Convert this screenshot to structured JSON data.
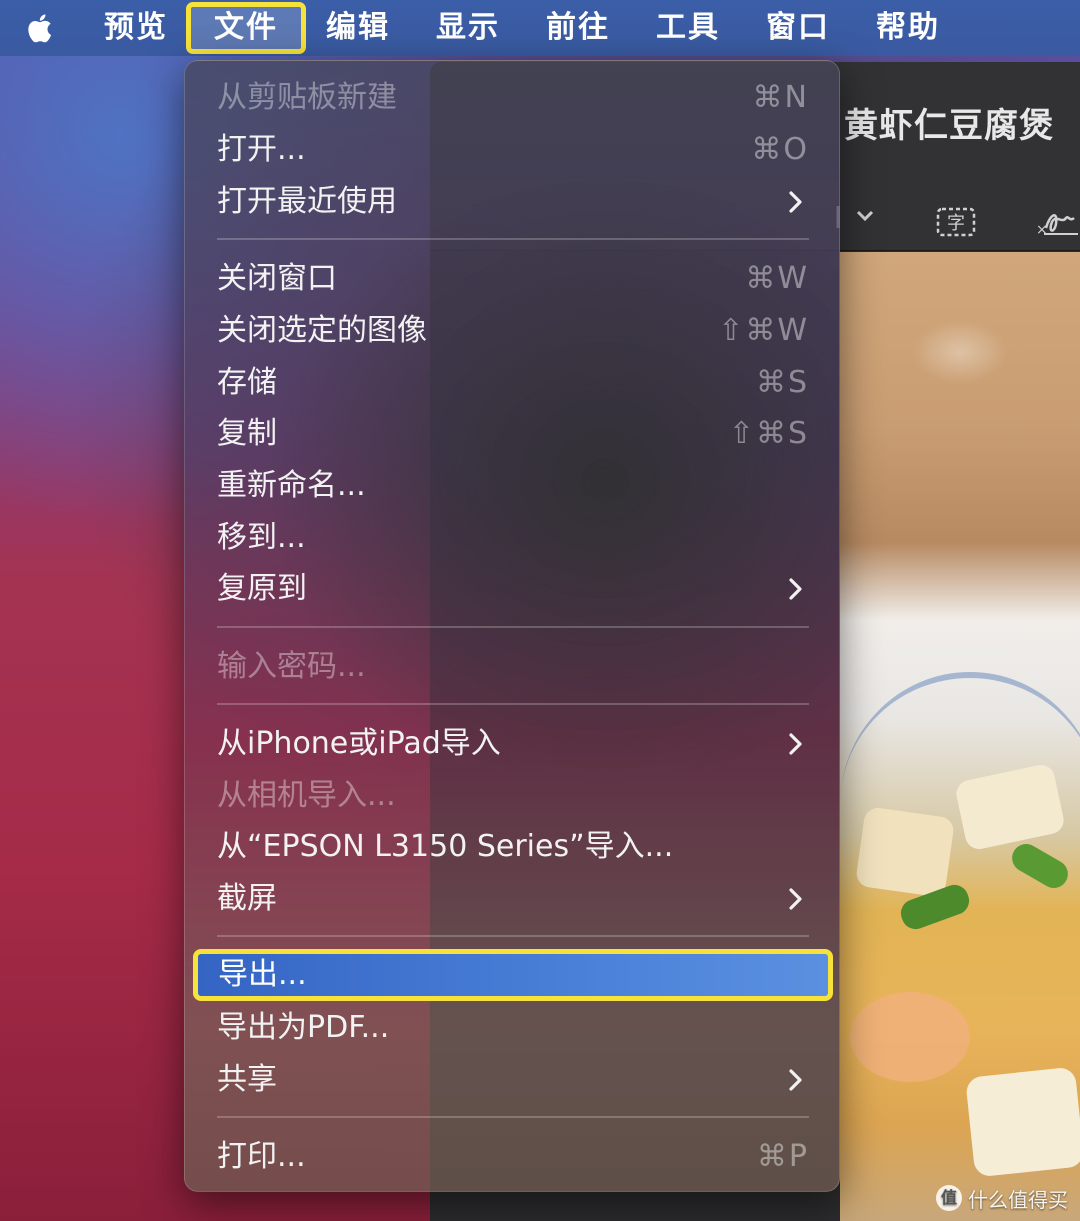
{
  "menubar": {
    "apple_icon": "apple-logo-icon",
    "items": [
      "预览",
      "文件",
      "编辑",
      "显示",
      "前往",
      "工具",
      "窗口",
      "帮助"
    ]
  },
  "window": {
    "title": "黄虾仁豆腐煲",
    "toolbar_icons": [
      "chevron-down-icon",
      "text-box-icon",
      "signature-icon"
    ]
  },
  "file_menu": {
    "items": [
      {
        "label": "从剪贴板新建",
        "shortcut": "⌘N",
        "disabled": true
      },
      {
        "label": "打开...",
        "shortcut": "⌘O"
      },
      {
        "label": "打开最近使用",
        "submenu": true
      },
      {
        "label": "关闭窗口",
        "shortcut": "⌘W"
      },
      {
        "label": "关闭选定的图像",
        "shortcut": "⇧⌘W"
      },
      {
        "label": "存储",
        "shortcut": "⌘S"
      },
      {
        "label": "复制",
        "shortcut": "⇧⌘S"
      },
      {
        "label": "重新命名..."
      },
      {
        "label": "移到..."
      },
      {
        "label": "复原到",
        "submenu": true
      },
      {
        "label": "输入密码...",
        "disabled": true
      },
      {
        "label": "从iPhone或iPad导入",
        "submenu": true
      },
      {
        "label": "从相机导入...",
        "disabled": true
      },
      {
        "label": "从“EPSON L3150 Series”导入..."
      },
      {
        "label": "截屏",
        "submenu": true
      },
      {
        "label": "导出...",
        "highlighted": true
      },
      {
        "label": "导出为PDF..."
      },
      {
        "label": "共享",
        "submenu": true
      },
      {
        "label": "打印...",
        "shortcut": "⌘P"
      }
    ]
  },
  "watermark": {
    "text": "什么值得买",
    "logo": "值"
  },
  "colors": {
    "highlight": "#4a80d8",
    "annotation": "#f7e23a",
    "menubar": "#3b5ea8"
  }
}
